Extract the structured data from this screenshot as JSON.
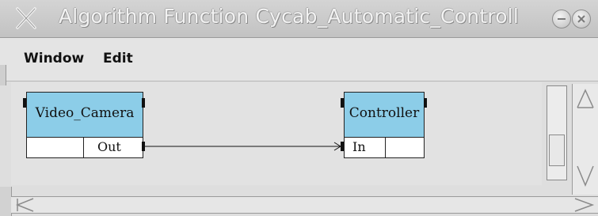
{
  "window": {
    "title": "Algorithm Function Cycab_Automatic_Controll",
    "title_icon": "x-app-icon",
    "controls": [
      "minimize-icon",
      "close-icon"
    ]
  },
  "menubar": {
    "items": [
      {
        "label": "Window"
      },
      {
        "label": "Edit"
      }
    ]
  },
  "canvas": {
    "nodes": [
      {
        "name": "Video_Camera",
        "ports": [
          {
            "label": ""
          },
          {
            "label": "Out"
          }
        ]
      },
      {
        "name": "Controller",
        "ports": [
          {
            "label": "In"
          },
          {
            "label": ""
          }
        ]
      }
    ],
    "connection": {
      "from": "Video_Camera.Out",
      "to": "Controller.In"
    }
  },
  "colors": {
    "node_fill": "#8ccde8",
    "background": "#e2e2e2",
    "titlebar": "#c8c8c8"
  },
  "scrollbars": {
    "vertical": "scroll-up-down",
    "horizontal": "scroll-left-right"
  }
}
